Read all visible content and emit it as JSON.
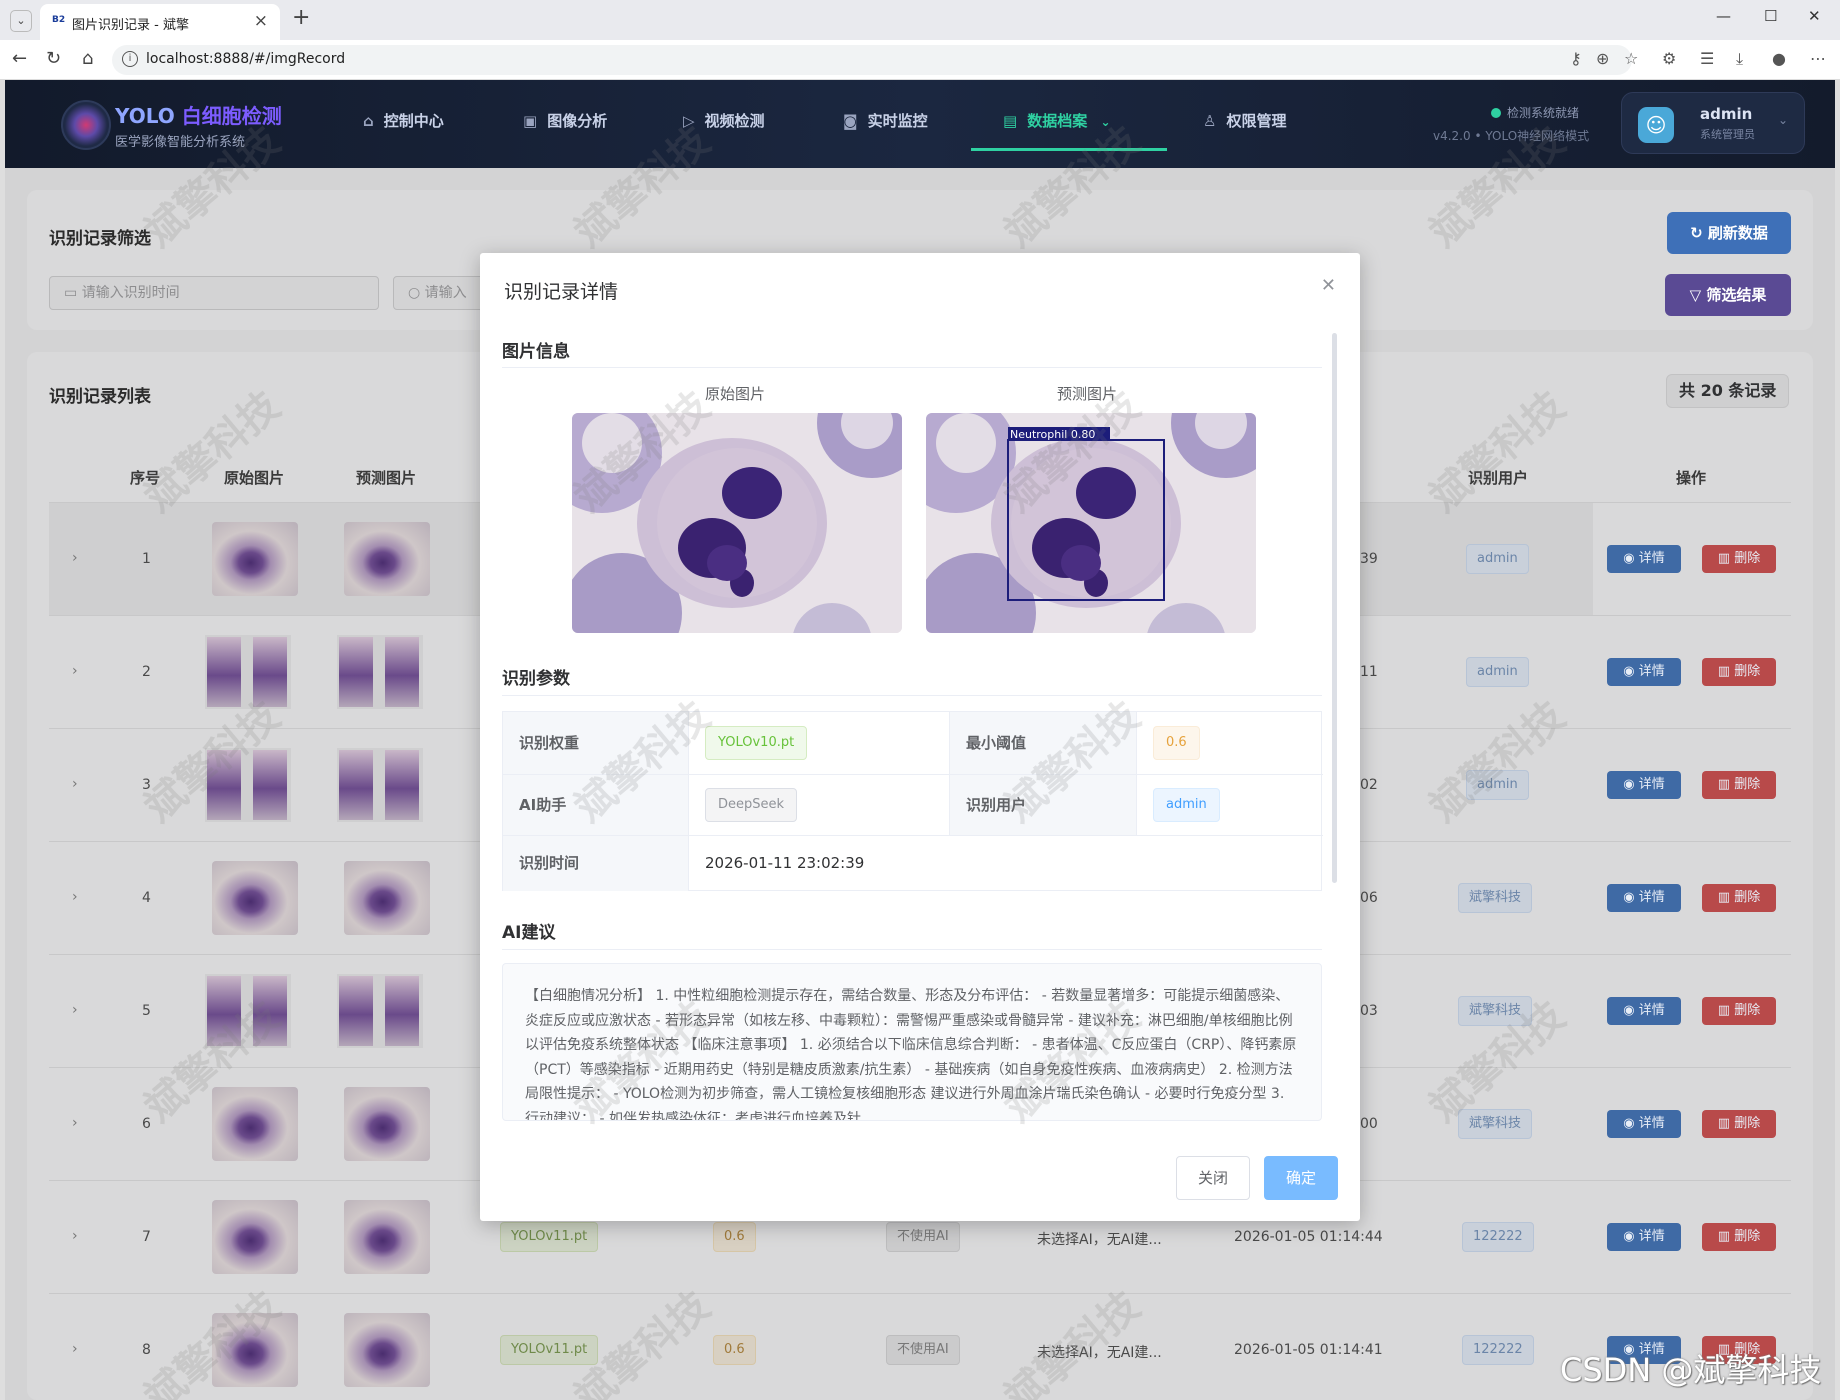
{
  "browser": {
    "tab_title": "图片识别记录 - 斌擎",
    "favicon": "B2",
    "url": "localhost:8888/#/imgRecord"
  },
  "header": {
    "brand": "YOLO",
    "brand_highlight": "白细胞检测",
    "subtitle": "医学影像智能分析系统",
    "nav": [
      {
        "label": "控制中心",
        "icon": "home-icon"
      },
      {
        "label": "图像分析",
        "icon": "image-icon"
      },
      {
        "label": "视频检测",
        "icon": "play-icon"
      },
      {
        "label": "实时监控",
        "icon": "camera-icon"
      },
      {
        "label": "数据档案",
        "icon": "document-icon",
        "active": true
      },
      {
        "label": "权限管理",
        "icon": "user-icon"
      }
    ],
    "status": "检测系统就绪",
    "version": "v4.2.0 • YOLO神经网络模式",
    "user_name": "admin",
    "user_role": "系统管理员"
  },
  "filter": {
    "title": "识别记录筛选",
    "time_placeholder": "请输入识别时间",
    "search_placeholder": "请输入",
    "refresh_label": "刷新数据",
    "filter_label": "筛选结果"
  },
  "list": {
    "title": "识别记录列表",
    "count_label": "共 20 条记录",
    "columns": {
      "index": "序号",
      "original": "原始图片",
      "predicted": "预测图片",
      "user": "识别用户",
      "actions": "操作"
    },
    "rows": [
      {
        "index": "1",
        "time_tail": "39",
        "user": "admin"
      },
      {
        "index": "2",
        "time_tail": "11",
        "user": "admin"
      },
      {
        "index": "3",
        "time_tail": "02",
        "user": "admin"
      },
      {
        "index": "4",
        "time_tail": "06",
        "user": "斌擎科技"
      },
      {
        "index": "5",
        "time_tail": "03",
        "user": "斌擎科技"
      },
      {
        "index": "6",
        "time_tail": "00",
        "user": "斌擎科技"
      },
      {
        "index": "7",
        "weight": "YOLOv11.pt",
        "conf": "0.6",
        "ai": "不使用AI",
        "advice": "未选择AI，无AI建...",
        "time": "2026-01-05 01:14:44",
        "user": "122222"
      },
      {
        "index": "8",
        "weight": "YOLOv11.pt",
        "conf": "0.6",
        "ai": "不使用AI",
        "advice": "未选择AI，无AI建...",
        "time": "2026-01-05 01:14:41",
        "user": "122222"
      }
    ],
    "detail_label": "详情",
    "delete_label": "删除"
  },
  "modal": {
    "title": "识别记录详情",
    "section_image": "图片信息",
    "original_label": "原始图片",
    "predicted_label": "预测图片",
    "detection_label": "Neutrophil 0.80",
    "section_params": "识别参数",
    "params": {
      "weight_label": "识别权重",
      "weight": "YOLOv10.pt",
      "conf_label": "最小阈值",
      "conf": "0.6",
      "ai_label": "AI助手",
      "ai": "DeepSeek",
      "user_label": "识别用户",
      "user": "admin",
      "time_label": "识别时间",
      "time": "2026-01-11 23:02:39"
    },
    "section_ai": "AI建议",
    "ai_text": "【白细胞情况分析】 1. 中性粒细胞检测提示存在，需结合数量、形态及分布评估： - 若数量显著增多：可能提示细菌感染、炎症反应或应激状态 - 若形态异常（如核左移、中毒颗粒）：需警惕严重感染或骨髓异常 - 建议补充：淋巴细胞/单核细胞比例以评估免疫系统整体状态 【临床注意事项】 1. 必须结合以下临床信息综合判断： - 患者体温、C反应蛋白（CRP）、降钙素原（PCT）等感染指标 - 近期用药史（特别是糖皮质激素/抗生素） - 基础疾病（如自身免疫性疾病、血液病病史） 2. 检测方法局限性提示： - YOLO检测为初步筛查，需人工镜检复核细胞形态 建议进行外周血涂片瑞氏染色确认 - 必要时行免疫分型 3. 行动建议： - 如伴发热感染体征：考虑进行血培养及针",
    "close_label": "关闭",
    "confirm_label": "确定"
  },
  "watermark": "斌擎科技",
  "corner_watermark": "CSDN @斌擎科技"
}
